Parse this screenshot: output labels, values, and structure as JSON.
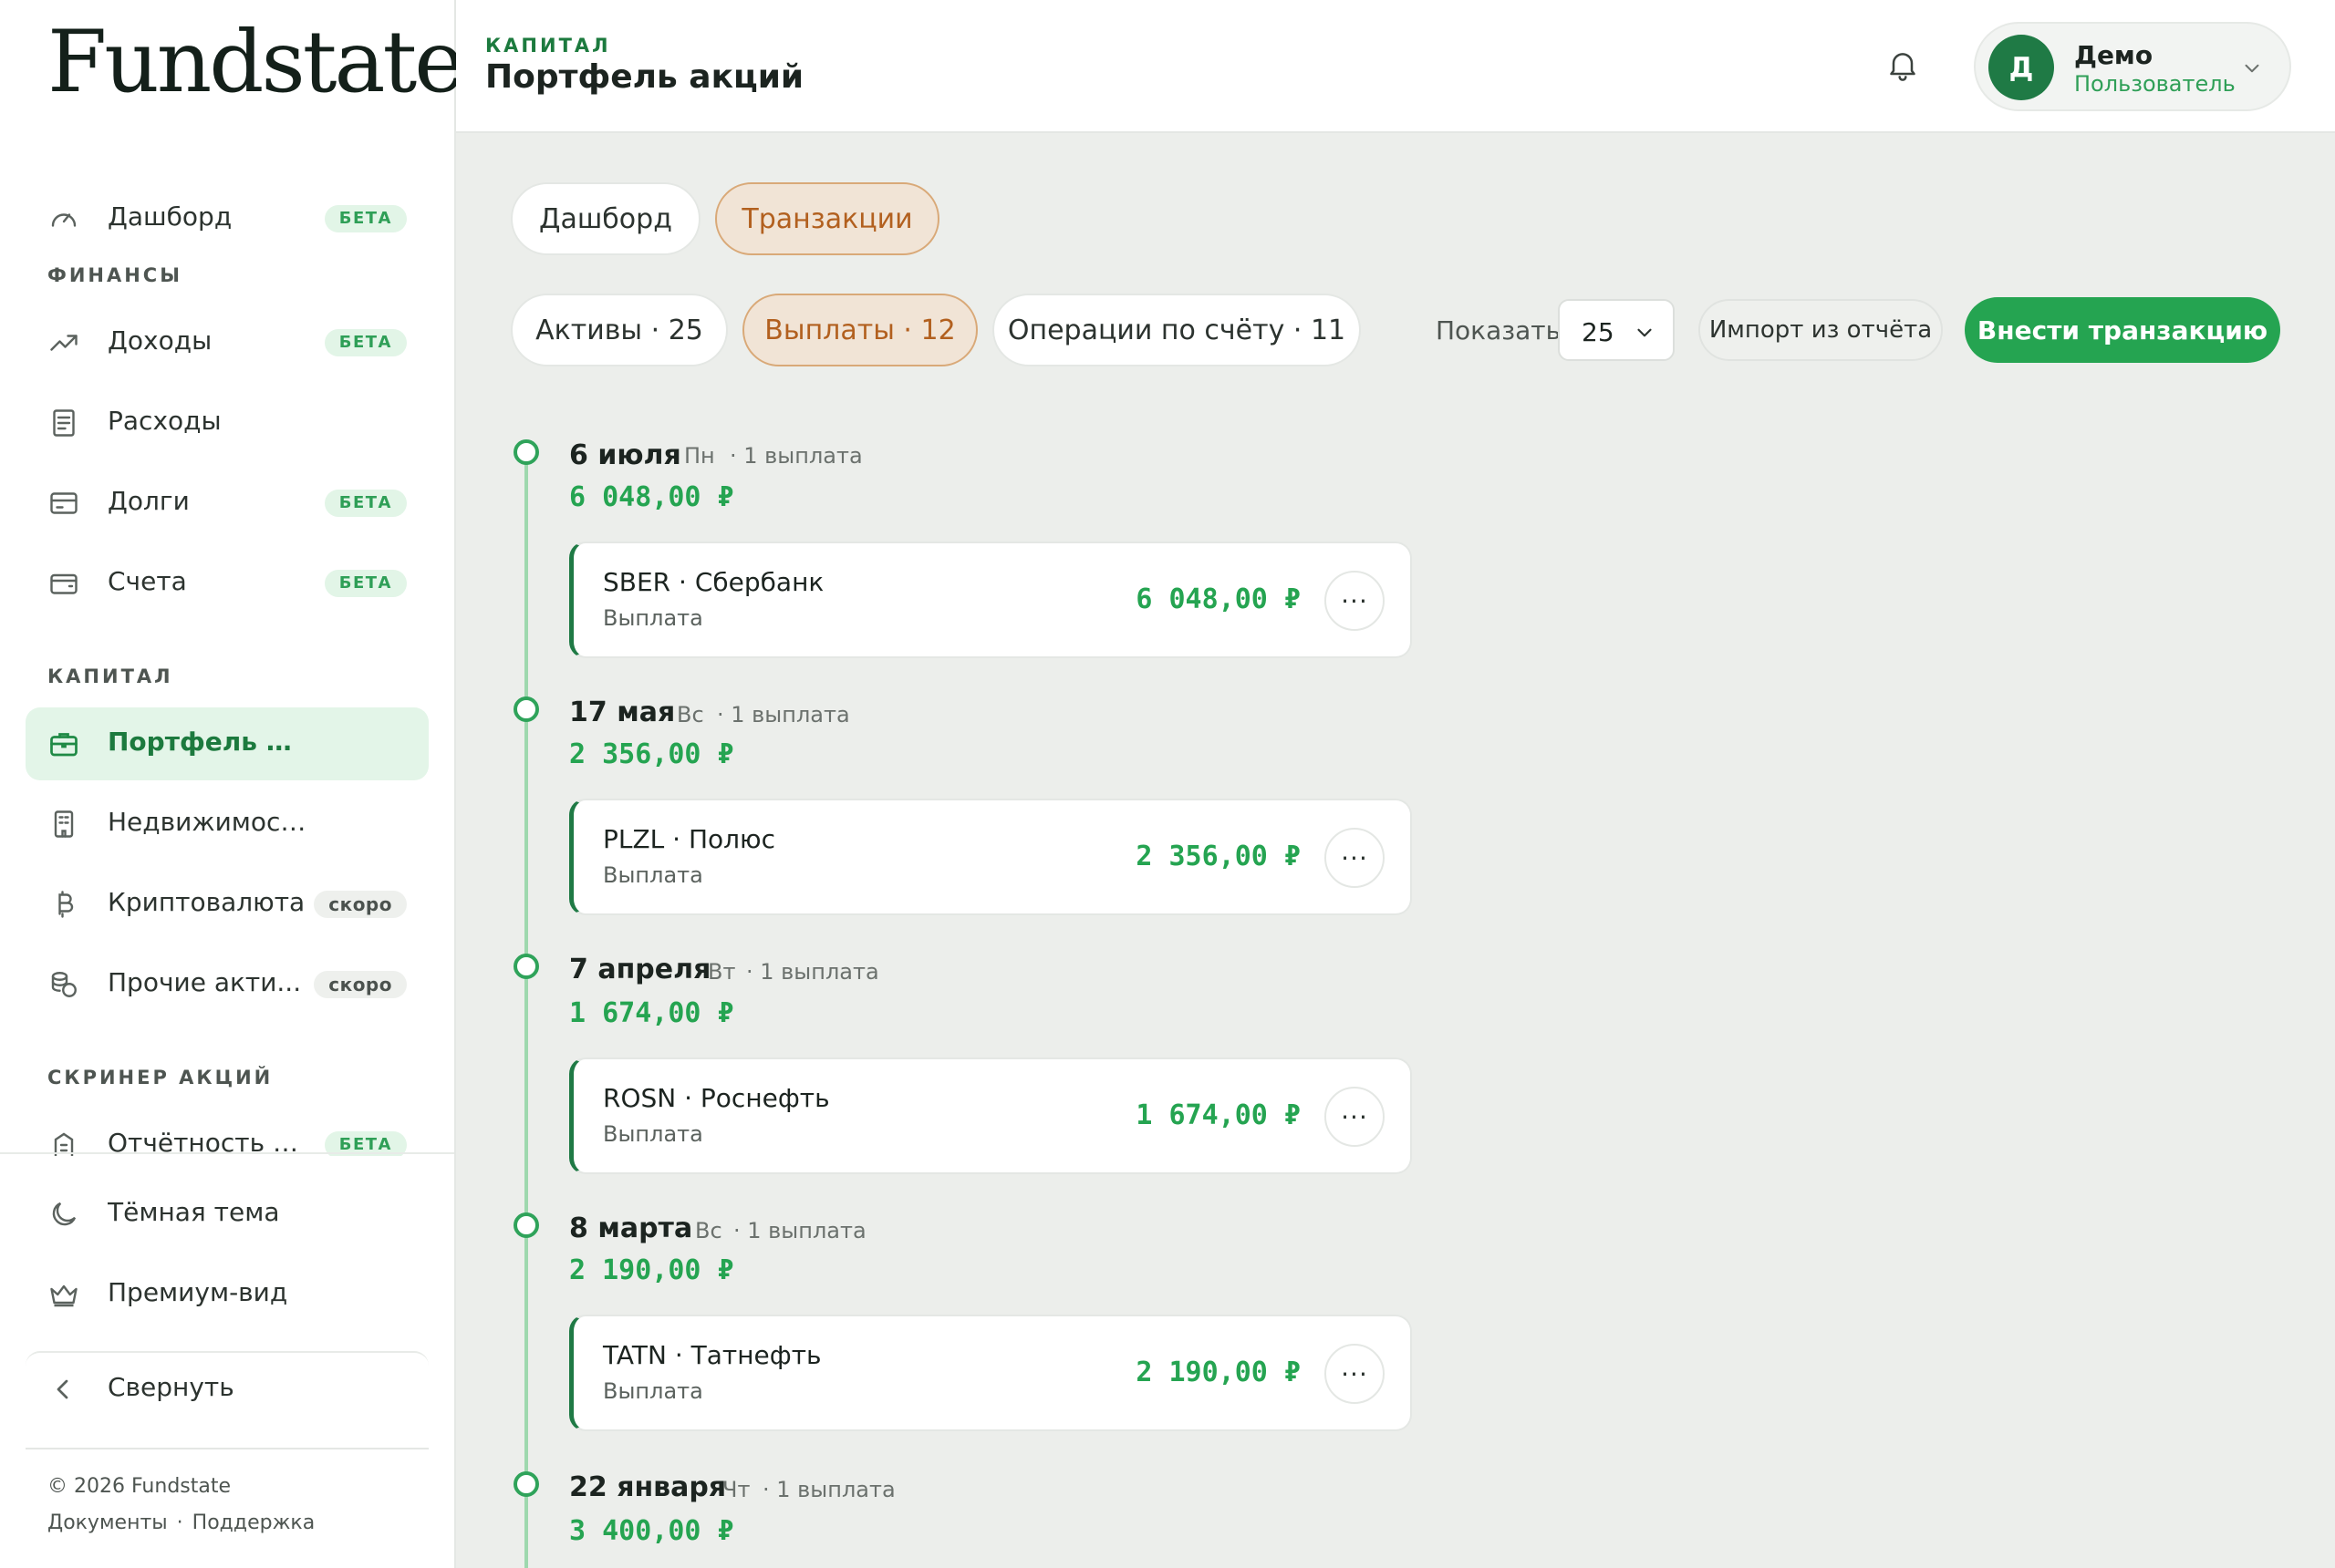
{
  "brand": {
    "name": "Fundstate"
  },
  "sidebar": {
    "top_item": {
      "label": "Дашборд",
      "badge": "БЕТА",
      "icon": "gauge-icon"
    },
    "sections": [
      {
        "title": "ФИНАНСЫ"
      },
      {
        "title": "КАПИТАЛ"
      },
      {
        "title": "СКРИНЕР АКЦИЙ"
      }
    ],
    "items": [
      {
        "label": "Доходы",
        "badge": "БЕТА",
        "icon": "trending-up-icon"
      },
      {
        "label": "Расходы",
        "badge": "",
        "icon": "receipt-icon"
      },
      {
        "label": "Долги",
        "badge": "БЕТА",
        "icon": "credit-card-icon"
      },
      {
        "label": "Счета",
        "badge": "БЕТА",
        "icon": "wallet-icon"
      },
      {
        "label": "Портфель акций",
        "badge": "",
        "icon": "briefcase-icon",
        "active": true
      },
      {
        "label": "Недвижимость",
        "badge": "",
        "icon": "building-icon"
      },
      {
        "label": "Криптовалюта",
        "badge": "скоро",
        "icon": "bitcoin-icon"
      },
      {
        "label": "Прочие акти...",
        "badge": "скоро",
        "icon": "coins-icon"
      },
      {
        "label": "Отчётность ко...",
        "badge": "БЕТА",
        "icon": "report-icon"
      }
    ],
    "bottom": {
      "dark_theme": "Тёмная тема",
      "premium": "Премиум-вид",
      "collapse": "Свернуть"
    },
    "footer": {
      "copyright": "© 2026 Fundstate",
      "docs": "Документы",
      "separator": "·",
      "support": "Поддержка"
    }
  },
  "header": {
    "eyebrow": "КАПИТАЛ",
    "title": "Портфель акций",
    "user": {
      "initial": "Д",
      "name": "Демо",
      "role": "Пользователь"
    }
  },
  "tabs": [
    {
      "label": "Дашборд",
      "selected": false
    },
    {
      "label": "Транзакции",
      "selected": true
    }
  ],
  "filters": [
    {
      "label": "Активы · 25",
      "selected": false
    },
    {
      "label": "Выплаты · 12",
      "selected": true
    },
    {
      "label": "Операции по счёту · 11",
      "selected": false
    }
  ],
  "controls": {
    "show_label": "Показать",
    "page_size": "25",
    "import_label": "Импорт из отчёта",
    "add_label": "Внести транзакцию"
  },
  "groups": [
    {
      "date": "6 июля",
      "weekday": "Пн",
      "count": "· 1 выплата",
      "total": "6 048,00 ₽",
      "items": [
        {
          "title": "SBER · Сбербанк",
          "type": "Выплата",
          "amount": "6 048,00 ₽"
        }
      ]
    },
    {
      "date": "17 мая",
      "weekday": "Вс",
      "count": "· 1 выплата",
      "total": "2 356,00 ₽",
      "items": [
        {
          "title": "PLZL · Полюс",
          "type": "Выплата",
          "amount": "2 356,00 ₽"
        }
      ]
    },
    {
      "date": "7 апреля",
      "weekday": "Вт",
      "count": "· 1 выплата",
      "total": "1 674,00 ₽",
      "items": [
        {
          "title": "ROSN · Роснефть",
          "type": "Выплата",
          "amount": "1 674,00 ₽"
        }
      ]
    },
    {
      "date": "8 марта",
      "weekday": "Вс",
      "count": "· 1 выплата",
      "total": "2 190,00 ₽",
      "items": [
        {
          "title": "TATN · Татнефть",
          "type": "Выплата",
          "amount": "2 190,00 ₽"
        }
      ]
    },
    {
      "date": "22 января",
      "weekday": "Чт",
      "count": "· 1 выплата",
      "total": "3 400,00 ₽",
      "items": []
    }
  ],
  "more_glyph": "···",
  "colors": {
    "brand_green": "#25a451",
    "dark_green": "#1f7a45",
    "selected_tab_bg": "#f1e4d6",
    "selected_tab_text": "#b2601f",
    "background": "#eceeeb"
  }
}
